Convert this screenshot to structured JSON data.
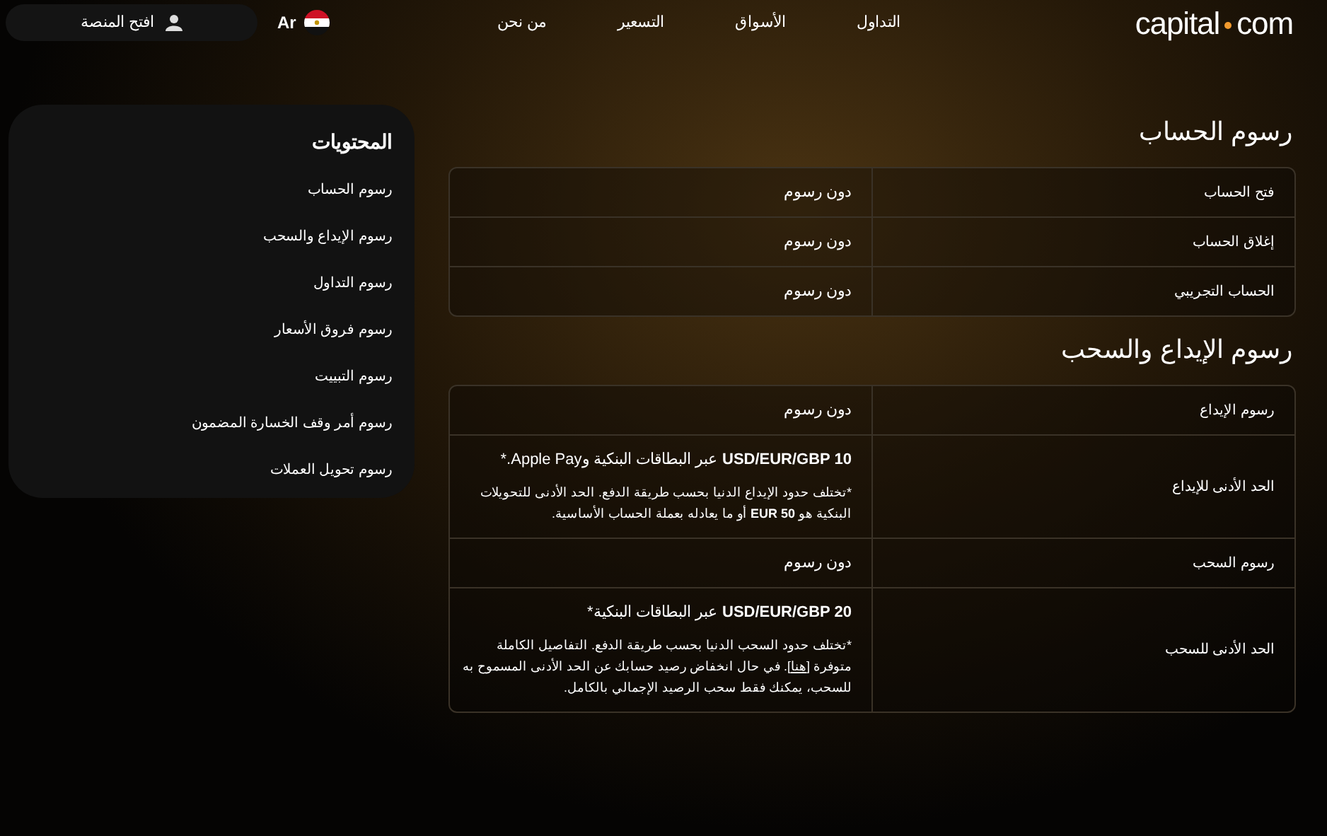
{
  "header": {
    "logo": {
      "left": "capital",
      "right": "com"
    },
    "nav": [
      "التداول",
      "الأسواق",
      "التسعير",
      "من نحن"
    ],
    "language": "Ar",
    "open_platform": "افتح المنصة"
  },
  "contents": {
    "title": "المحتويات",
    "items": [
      "رسوم الحساب",
      "رسوم الإيداع والسحب",
      "رسوم التداول",
      "رسوم فروق الأسعار",
      "رسوم التبييت",
      "رسوم أمر وقف الخسارة المضمون",
      "رسوم تحويل العملات"
    ]
  },
  "sections": [
    {
      "title": "رسوم الحساب",
      "rows": [
        {
          "label": "فتح الحساب",
          "value": "دون رسوم"
        },
        {
          "label": "إغلاق الحساب",
          "value": "دون رسوم"
        },
        {
          "label": "الحساب التجريبي",
          "value": "دون رسوم"
        }
      ]
    },
    {
      "title": "رسوم الإيداع والسحب",
      "rows": [
        {
          "label": "رسوم الإيداع",
          "value": "دون رسوم"
        },
        {
          "label": "الحد الأدنى للإيداع",
          "value": "**USD/EUR/GBP 10** عبر البطاقات البنكية وApple Pay.*",
          "note": [
            {
              "kind": "text",
              "text": "*تختلف حدود الإيداع الدنيا بحسب طريقة الدفع. الحد الأدنى للتحويلات البنكية هو **EUR 50** أو ما يعادله بعملة الحساب الأساسية."
            }
          ]
        },
        {
          "label": "رسوم السحب",
          "value": "دون رسوم"
        },
        {
          "label": "الحد الأدنى للسحب",
          "value": "**USD/EUR/GBP 20** عبر البطاقات البنكية*",
          "note": [
            {
              "kind": "text",
              "text": "*تختلف حدود السحب الدنيا بحسب طريقة الدفع. التفاصيل الكاملة متوفرة ["
            },
            {
              "kind": "link",
              "text": "هنا"
            },
            {
              "kind": "text",
              "text": "]. في حال انخفاض رصيد حسابك عن الحد الأدنى المسموح به للسحب، يمكنك فقط سحب الرصيد الإجمالي بالكامل."
            }
          ]
        }
      ]
    }
  ]
}
